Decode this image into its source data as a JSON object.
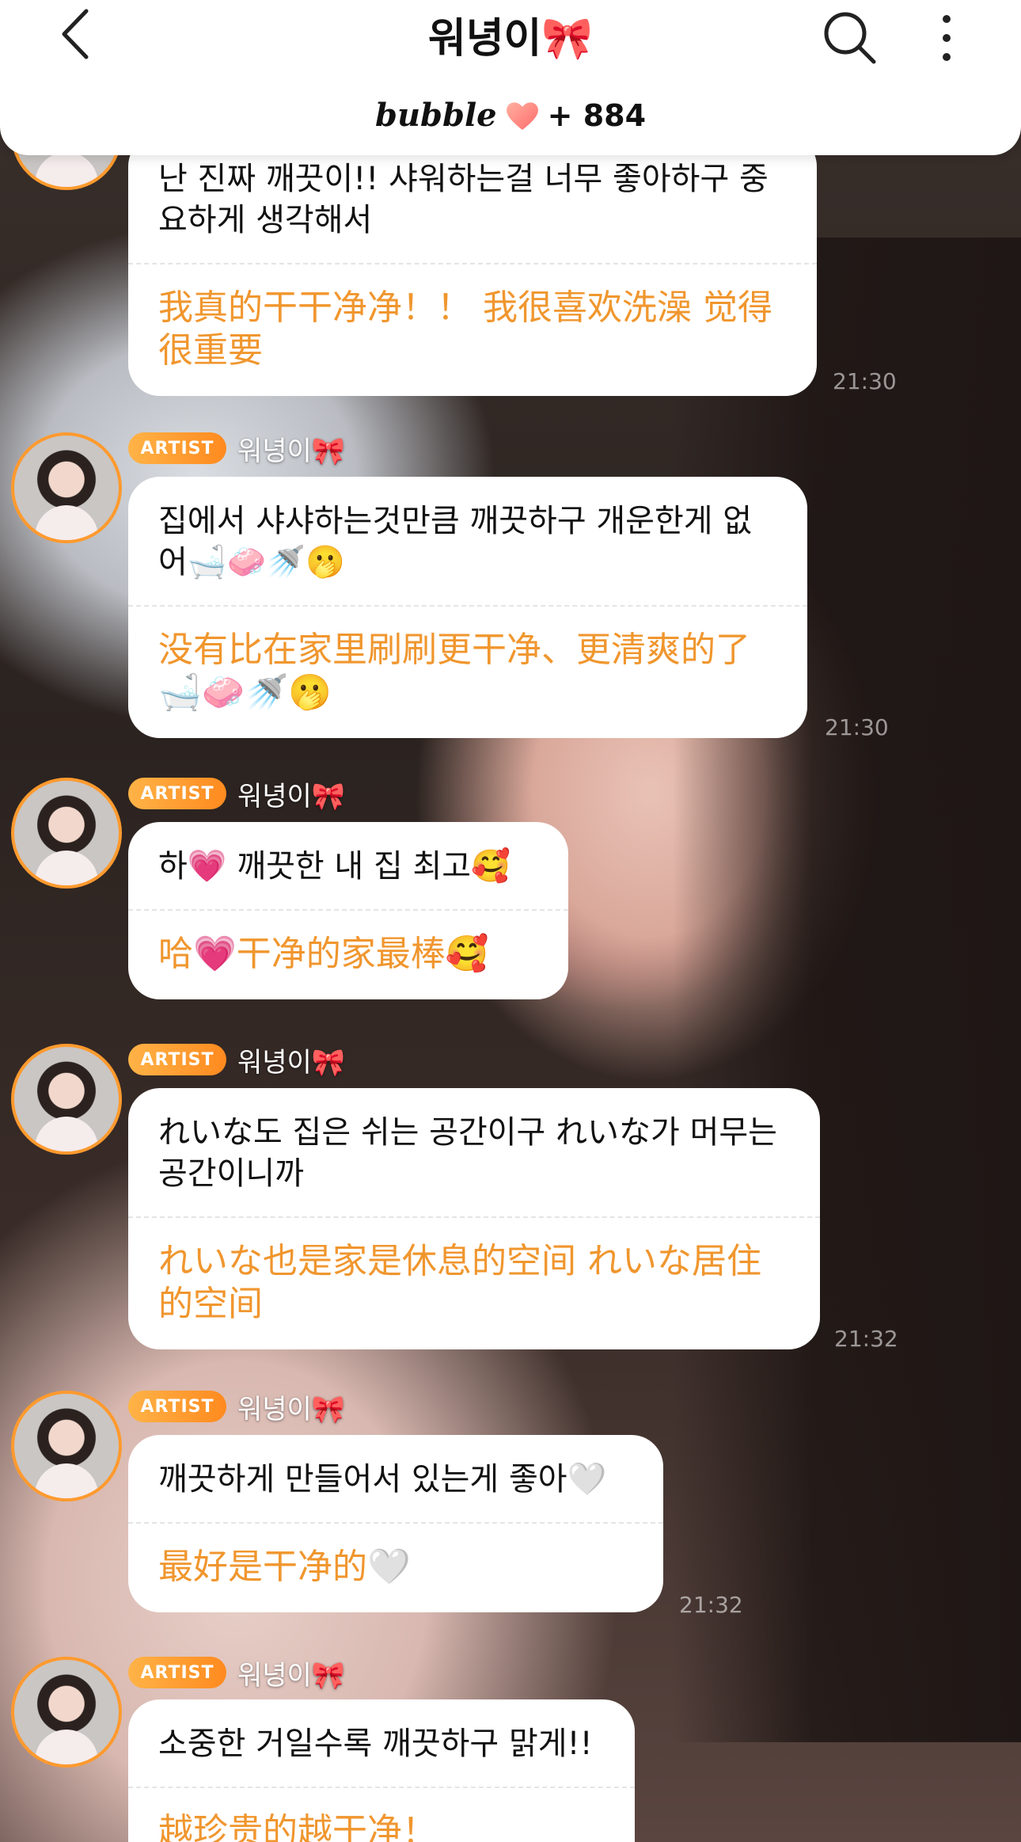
{
  "header": {
    "title": "워녕이🎀",
    "bubble_brand": "bubble",
    "bubble_count": "+ 884"
  },
  "colors": {
    "accent": "#ff9a2e",
    "translation_text": "#f0962e",
    "badge_gradient_start": "#ffb347",
    "badge_gradient_end": "#ff8a1f"
  },
  "icons": {
    "back": "chevron-left-icon",
    "search": "search-icon",
    "more": "more-vertical-icon",
    "heart": "heart-icon"
  },
  "messages": [
    {
      "badge": "",
      "sender": "",
      "ko": "난 진짜 깨끗이!! 샤워하는걸 너무 좋아하구 중요하게 생각해서",
      "zh": "我真的干干净净！！ 我很喜欢洗澡 觉得很重要",
      "time": "21:30"
    },
    {
      "badge": "ARTIST",
      "sender": "워녕이🎀",
      "ko": "집에서 샤샤하는것만큼 깨끗하구 개운한게 없어🛁🧼🚿🫢",
      "zh": "没有比在家里刷刷更干净、更清爽的了🛁🧼🚿🫢",
      "time": "21:30"
    },
    {
      "badge": "ARTIST",
      "sender": "워녕이🎀",
      "ko": "하💗 깨끗한 내 집 최고🥰",
      "zh": "哈💗干净的家最棒🥰",
      "time": ""
    },
    {
      "badge": "ARTIST",
      "sender": "워녕이🎀",
      "ko": "れいな도 집은 쉬는 공간이구 れいな가 머무는 공간이니까",
      "zh": "れいな也是家是休息的空间 れいな居住的空间",
      "time": "21:32"
    },
    {
      "badge": "ARTIST",
      "sender": "워녕이🎀",
      "ko": "깨끗하게 만들어서 있는게 좋아🤍",
      "zh": "最好是干净的🤍",
      "time": "21:32"
    },
    {
      "badge": "ARTIST",
      "sender": "워녕이🎀",
      "ko": "소중한 거일수록 깨끗하구 맑게!!",
      "zh": "越珍贵的越干净！",
      "time": ""
    }
  ]
}
